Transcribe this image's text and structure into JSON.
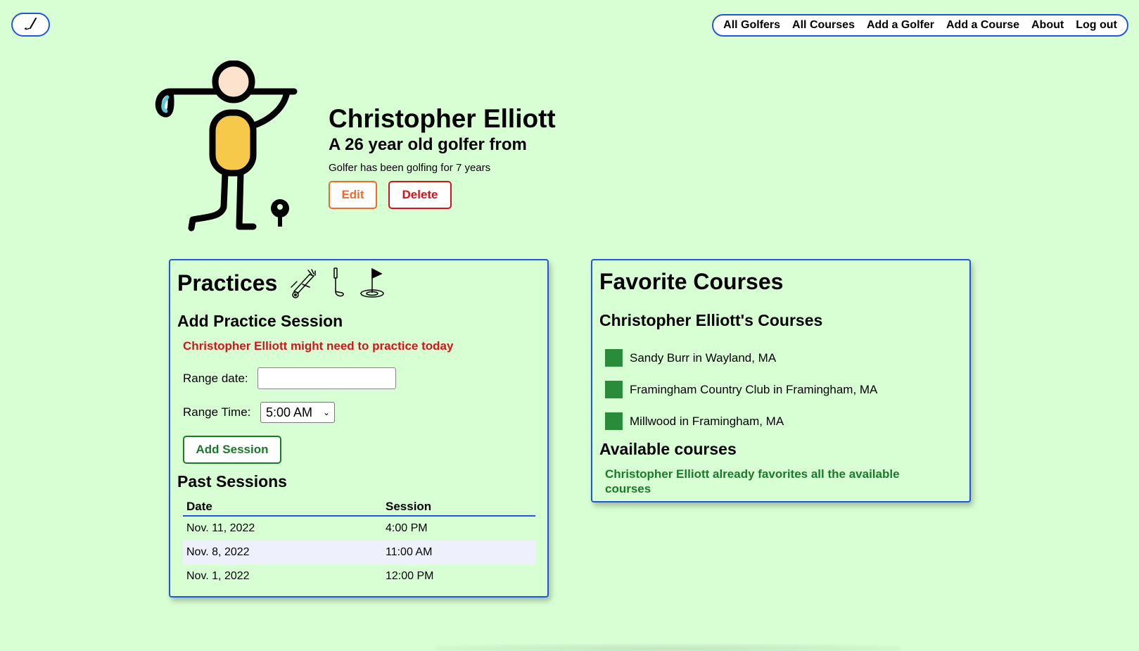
{
  "nav": {
    "logo_icon": "golf-club-icon",
    "links": [
      "All Golfers",
      "All Courses",
      "Add a Golfer",
      "Add a Course",
      "About",
      "Log out"
    ]
  },
  "profile": {
    "name": "Christopher Elliott",
    "subtitle": "A 26 year old golfer from",
    "experience": "Golfer has been golfing for 7 years",
    "edit_label": "Edit",
    "delete_label": "Delete"
  },
  "practices": {
    "title": "Practices",
    "icons": [
      "golf-bag-cart-icon",
      "golf-club-icon",
      "golf-flag-hole-icon"
    ],
    "add_heading": "Add Practice Session",
    "warning": "Christopher Elliott might need to practice today",
    "range_date_label": "Range date:",
    "range_date_value": "",
    "range_time_label": "Range Time:",
    "range_time_value": "5:00 AM",
    "add_button": "Add Session",
    "past_heading": "Past Sessions",
    "columns": [
      "Date",
      "Session"
    ],
    "rows": [
      {
        "date": "Nov. 11, 2022",
        "session": "4:00 PM"
      },
      {
        "date": "Nov. 8, 2022",
        "session": "11:00 AM"
      },
      {
        "date": "Nov. 1, 2022",
        "session": "12:00 PM"
      }
    ]
  },
  "favorites": {
    "title": "Favorite Courses",
    "courses_heading": "Christopher Elliott's Courses",
    "courses": [
      "Sandy Burr in Wayland, MA",
      "Framingham Country Club in Framingham, MA",
      "Millwood in Framingham, MA"
    ],
    "available_heading": "Available courses",
    "available_note": "Christopher Elliott already favorites all the available courses"
  },
  "colors": {
    "background": "#d8ffd4",
    "accent_border": "#2255dd",
    "danger": "#d4141c",
    "edit": "#f06a2a",
    "success": "#1a7a2a",
    "course_marker": "#2a8c3a"
  }
}
